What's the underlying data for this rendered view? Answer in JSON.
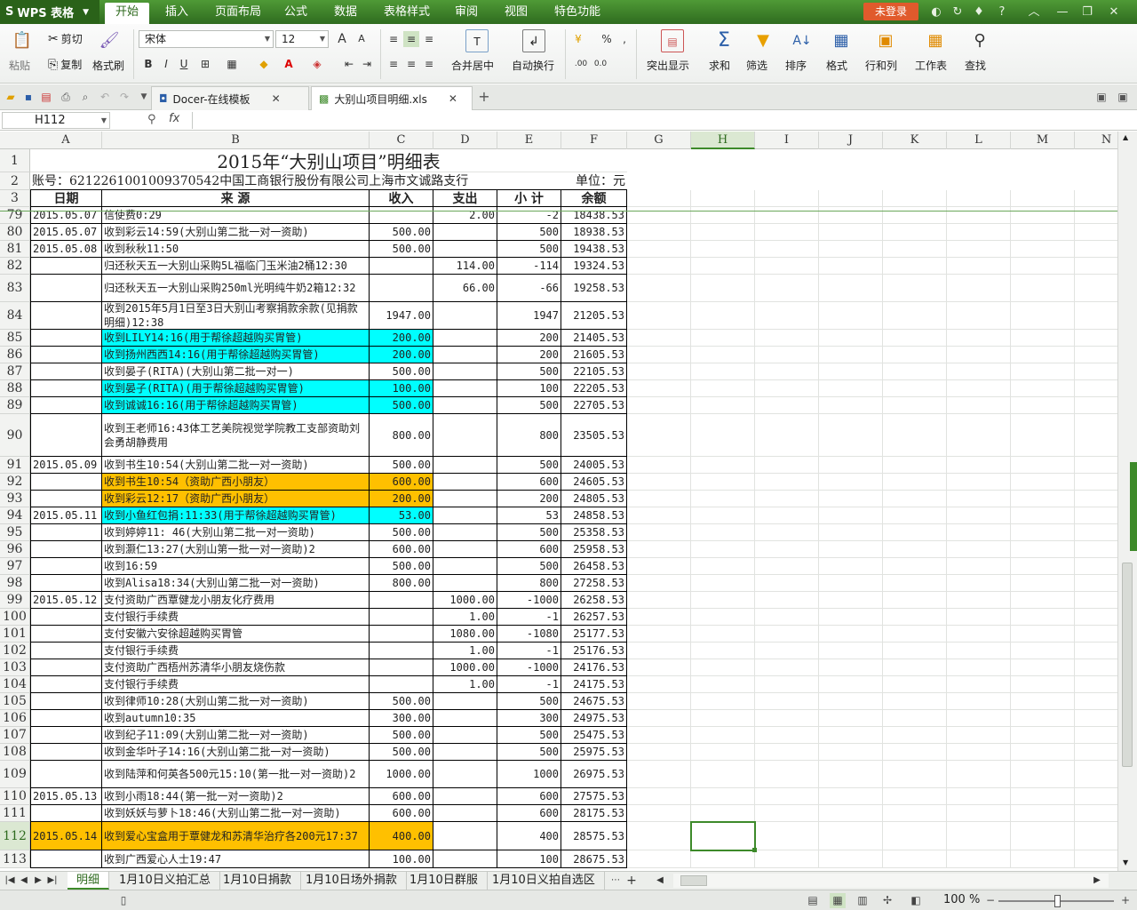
{
  "app": {
    "name": "WPS 表格",
    "logo": "S"
  },
  "menu": [
    "开始",
    "插入",
    "页面布局",
    "公式",
    "数据",
    "表格样式",
    "审阅",
    "视图",
    "特色功能"
  ],
  "login": "未登录",
  "ribbon": {
    "paste": "粘贴",
    "cut": "剪切",
    "copy": "复制",
    "format_painter": "格式刷",
    "font_name": "宋体",
    "font_size": "12",
    "bold": "B",
    "italic": "I",
    "underline": "U",
    "merge_center": "合并居中",
    "wrap": "自动换行",
    "percent": "%",
    "comma": ",",
    "dec_inc": ".00",
    "dec_dec": "0.0",
    "highlight": "突出显示",
    "sum": "求和",
    "filter": "筛选",
    "sort": "排序",
    "format": "格式",
    "rows_cols": "行和列",
    "worksheet": "工作表",
    "find": "查找"
  },
  "doc_tabs": [
    "Docer-在线模板",
    "大别山项目明细.xls"
  ],
  "name_box": "H112",
  "fx": "fx",
  "columns": [
    "A",
    "B",
    "C",
    "D",
    "E",
    "F",
    "G",
    "H",
    "I",
    "J",
    "K",
    "L",
    "M",
    "N"
  ],
  "sheet": {
    "title": "2015年“大别山项目”明细表",
    "account": "账号：6212261001009370542中国工商银行股份有限公司上海市文诚路支行",
    "unit": "单位：元",
    "headers": [
      "日期",
      "来 源",
      "收入",
      "支出",
      "小 计",
      "余额"
    ],
    "rows": [
      {
        "n": "79",
        "date": "2015.05.07",
        "src": "信使费0:29",
        "inc": "",
        "exp": "2.00",
        "sub": "-2",
        "bal": "18438.53",
        "fill": ""
      },
      {
        "n": "80",
        "date": "2015.05.07",
        "src": "收到彩云14:59(大别山第二批一对一资助)",
        "inc": "500.00",
        "exp": "",
        "sub": "500",
        "bal": "18938.53",
        "fill": ""
      },
      {
        "n": "81",
        "date": "2015.05.08",
        "src": "收到秋秋11:50",
        "inc": "500.00",
        "exp": "",
        "sub": "500",
        "bal": "19438.53",
        "fill": ""
      },
      {
        "n": "82",
        "date": "",
        "src": "归还秋天五一大别山采购5L福临门玉米油2桶12:30",
        "inc": "",
        "exp": "114.00",
        "sub": "-114",
        "bal": "19324.53",
        "fill": ""
      },
      {
        "n": "83",
        "date": "",
        "src": "归还秋天五一大别山采购250ml光明纯牛奶2箱12:32",
        "inc": "",
        "exp": "66.00",
        "sub": "-66",
        "bal": "19258.53",
        "fill": ""
      },
      {
        "n": "84",
        "date": "",
        "src": "收到2015年5月1日至3日大别山考察捐款余款(见捐款明细)12:38",
        "inc": "1947.00",
        "exp": "",
        "sub": "1947",
        "bal": "21205.53",
        "fill": ""
      },
      {
        "n": "85",
        "date": "",
        "src": "收到LILY14:16(用于帮徐超越购买胃管)",
        "inc": "200.00",
        "exp": "",
        "sub": "200",
        "bal": "21405.53",
        "fill": "cyan"
      },
      {
        "n": "86",
        "date": "",
        "src": "收到扬州西西14:16(用于帮徐超越购买胃管)",
        "inc": "200.00",
        "exp": "",
        "sub": "200",
        "bal": "21605.53",
        "fill": "cyan"
      },
      {
        "n": "87",
        "date": "",
        "src": "收到晏子(RITA)(大别山第二批一对一)",
        "inc": "500.00",
        "exp": "",
        "sub": "500",
        "bal": "22105.53",
        "fill": ""
      },
      {
        "n": "88",
        "date": "",
        "src": "收到晏子(RITA)(用于帮徐超越购买胃管)",
        "inc": "100.00",
        "exp": "",
        "sub": "100",
        "bal": "22205.53",
        "fill": "cyan"
      },
      {
        "n": "89",
        "date": "",
        "src": "收到诚诚16:16(用于帮徐超越购买胃管)",
        "inc": "500.00",
        "exp": "",
        "sub": "500",
        "bal": "22705.53",
        "fill": "cyan"
      },
      {
        "n": "90",
        "date": "",
        "src": "收到王老师16:43体工艺美院视觉学院教工支部资助刘会勇胡静费用",
        "inc": "800.00",
        "exp": "",
        "sub": "800",
        "bal": "23505.53",
        "fill": ""
      },
      {
        "n": "91",
        "date": "2015.05.09",
        "src": "收到书生10:54(大别山第二批一对一资助)",
        "inc": "500.00",
        "exp": "",
        "sub": "500",
        "bal": "24005.53",
        "fill": ""
      },
      {
        "n": "92",
        "date": "",
        "src": "收到书生10:54（资助广西小朋友）",
        "inc": "600.00",
        "exp": "",
        "sub": "600",
        "bal": "24605.53",
        "fill": "orange"
      },
      {
        "n": "93",
        "date": "",
        "src": "收到彩云12:17（资助广西小朋友）",
        "inc": "200.00",
        "exp": "",
        "sub": "200",
        "bal": "24805.53",
        "fill": "orange"
      },
      {
        "n": "94",
        "date": "2015.05.11",
        "src": "收到小鱼红包捐:11:33(用于帮徐超越购买胃管)",
        "inc": "53.00",
        "exp": "",
        "sub": "53",
        "bal": "24858.53",
        "fill": "cyan"
      },
      {
        "n": "95",
        "date": "",
        "src": "收到婷婷11: 46(大别山第二批一对一资助)",
        "inc": "500.00",
        "exp": "",
        "sub": "500",
        "bal": "25358.53",
        "fill": ""
      },
      {
        "n": "96",
        "date": "",
        "src": "收到灏仁13:27(大别山第一批一对一资助)2",
        "inc": "600.00",
        "exp": "",
        "sub": "600",
        "bal": "25958.53",
        "fill": ""
      },
      {
        "n": "97",
        "date": "",
        "src": "收到16:59",
        "inc": "500.00",
        "exp": "",
        "sub": "500",
        "bal": "26458.53",
        "fill": ""
      },
      {
        "n": "98",
        "date": "",
        "src": "收到Alisa18:34(大别山第二批一对一资助)",
        "inc": "800.00",
        "exp": "",
        "sub": "800",
        "bal": "27258.53",
        "fill": ""
      },
      {
        "n": "99",
        "date": "2015.05.12",
        "src": "支付资助广西覃健龙小朋友化疗费用",
        "inc": "",
        "exp": "1000.00",
        "sub": "-1000",
        "bal": "26258.53",
        "fill": ""
      },
      {
        "n": "100",
        "date": "",
        "src": "支付银行手续费",
        "inc": "",
        "exp": "1.00",
        "sub": "-1",
        "bal": "26257.53",
        "fill": ""
      },
      {
        "n": "101",
        "date": "",
        "src": "支付安徽六安徐超越购买胃管",
        "inc": "",
        "exp": "1080.00",
        "sub": "-1080",
        "bal": "25177.53",
        "fill": ""
      },
      {
        "n": "102",
        "date": "",
        "src": "支付银行手续费",
        "inc": "",
        "exp": "1.00",
        "sub": "-1",
        "bal": "25176.53",
        "fill": ""
      },
      {
        "n": "103",
        "date": "",
        "src": "支付资助广西梧州苏清华小朋友烧伤款",
        "inc": "",
        "exp": "1000.00",
        "sub": "-1000",
        "bal": "24176.53",
        "fill": ""
      },
      {
        "n": "104",
        "date": "",
        "src": "支付银行手续费",
        "inc": "",
        "exp": "1.00",
        "sub": "-1",
        "bal": "24175.53",
        "fill": ""
      },
      {
        "n": "105",
        "date": "",
        "src": "收到律师10:28(大别山第二批一对一资助)",
        "inc": "500.00",
        "exp": "",
        "sub": "500",
        "bal": "24675.53",
        "fill": ""
      },
      {
        "n": "106",
        "date": "",
        "src": "收到autumn10:35",
        "inc": "300.00",
        "exp": "",
        "sub": "300",
        "bal": "24975.53",
        "fill": ""
      },
      {
        "n": "107",
        "date": "",
        "src": "收到纪子11:09(大别山第二批一对一资助)",
        "inc": "500.00",
        "exp": "",
        "sub": "500",
        "bal": "25475.53",
        "fill": ""
      },
      {
        "n": "108",
        "date": "",
        "src": "收到金华叶子14:16(大别山第二批一对一资助)",
        "inc": "500.00",
        "exp": "",
        "sub": "500",
        "bal": "25975.53",
        "fill": ""
      },
      {
        "n": "109",
        "date": "",
        "src": "收到陆萍和何英各500元15:10(第一批一对一资助)2",
        "inc": "1000.00",
        "exp": "",
        "sub": "1000",
        "bal": "26975.53",
        "fill": ""
      },
      {
        "n": "110",
        "date": "2015.05.13",
        "src": "收到小雨18:44(第一批一对一资助)2",
        "inc": "600.00",
        "exp": "",
        "sub": "600",
        "bal": "27575.53",
        "fill": ""
      },
      {
        "n": "111",
        "date": "",
        "src": "收到妖妖与萝卜18:46(大别山第二批一对一资助)",
        "inc": "600.00",
        "exp": "",
        "sub": "600",
        "bal": "28175.53",
        "fill": ""
      },
      {
        "n": "112",
        "date": "2015.05.14",
        "src": "收到爱心宝盒用于覃健龙和苏清华治疗各200元17:37",
        "inc": "400.00",
        "exp": "",
        "sub": "400",
        "bal": "28575.53",
        "fill": "orange"
      },
      {
        "n": "113",
        "date": "",
        "src": "收到广西爱心人士19:47",
        "inc": "100.00",
        "exp": "",
        "sub": "100",
        "bal": "28675.53",
        "fill": ""
      }
    ]
  },
  "sheet_tabs": [
    "明细",
    "1月10日义拍汇总",
    "1月10日捐款",
    "1月10日场外捐款",
    "1月10日群服",
    "1月10日义拍自选区"
  ],
  "zoom": "100 %",
  "colors": {
    "brand": "#2f6b1f",
    "cyan": "#00ffff",
    "orange": "#ffc000",
    "login": "#e05a2c"
  }
}
